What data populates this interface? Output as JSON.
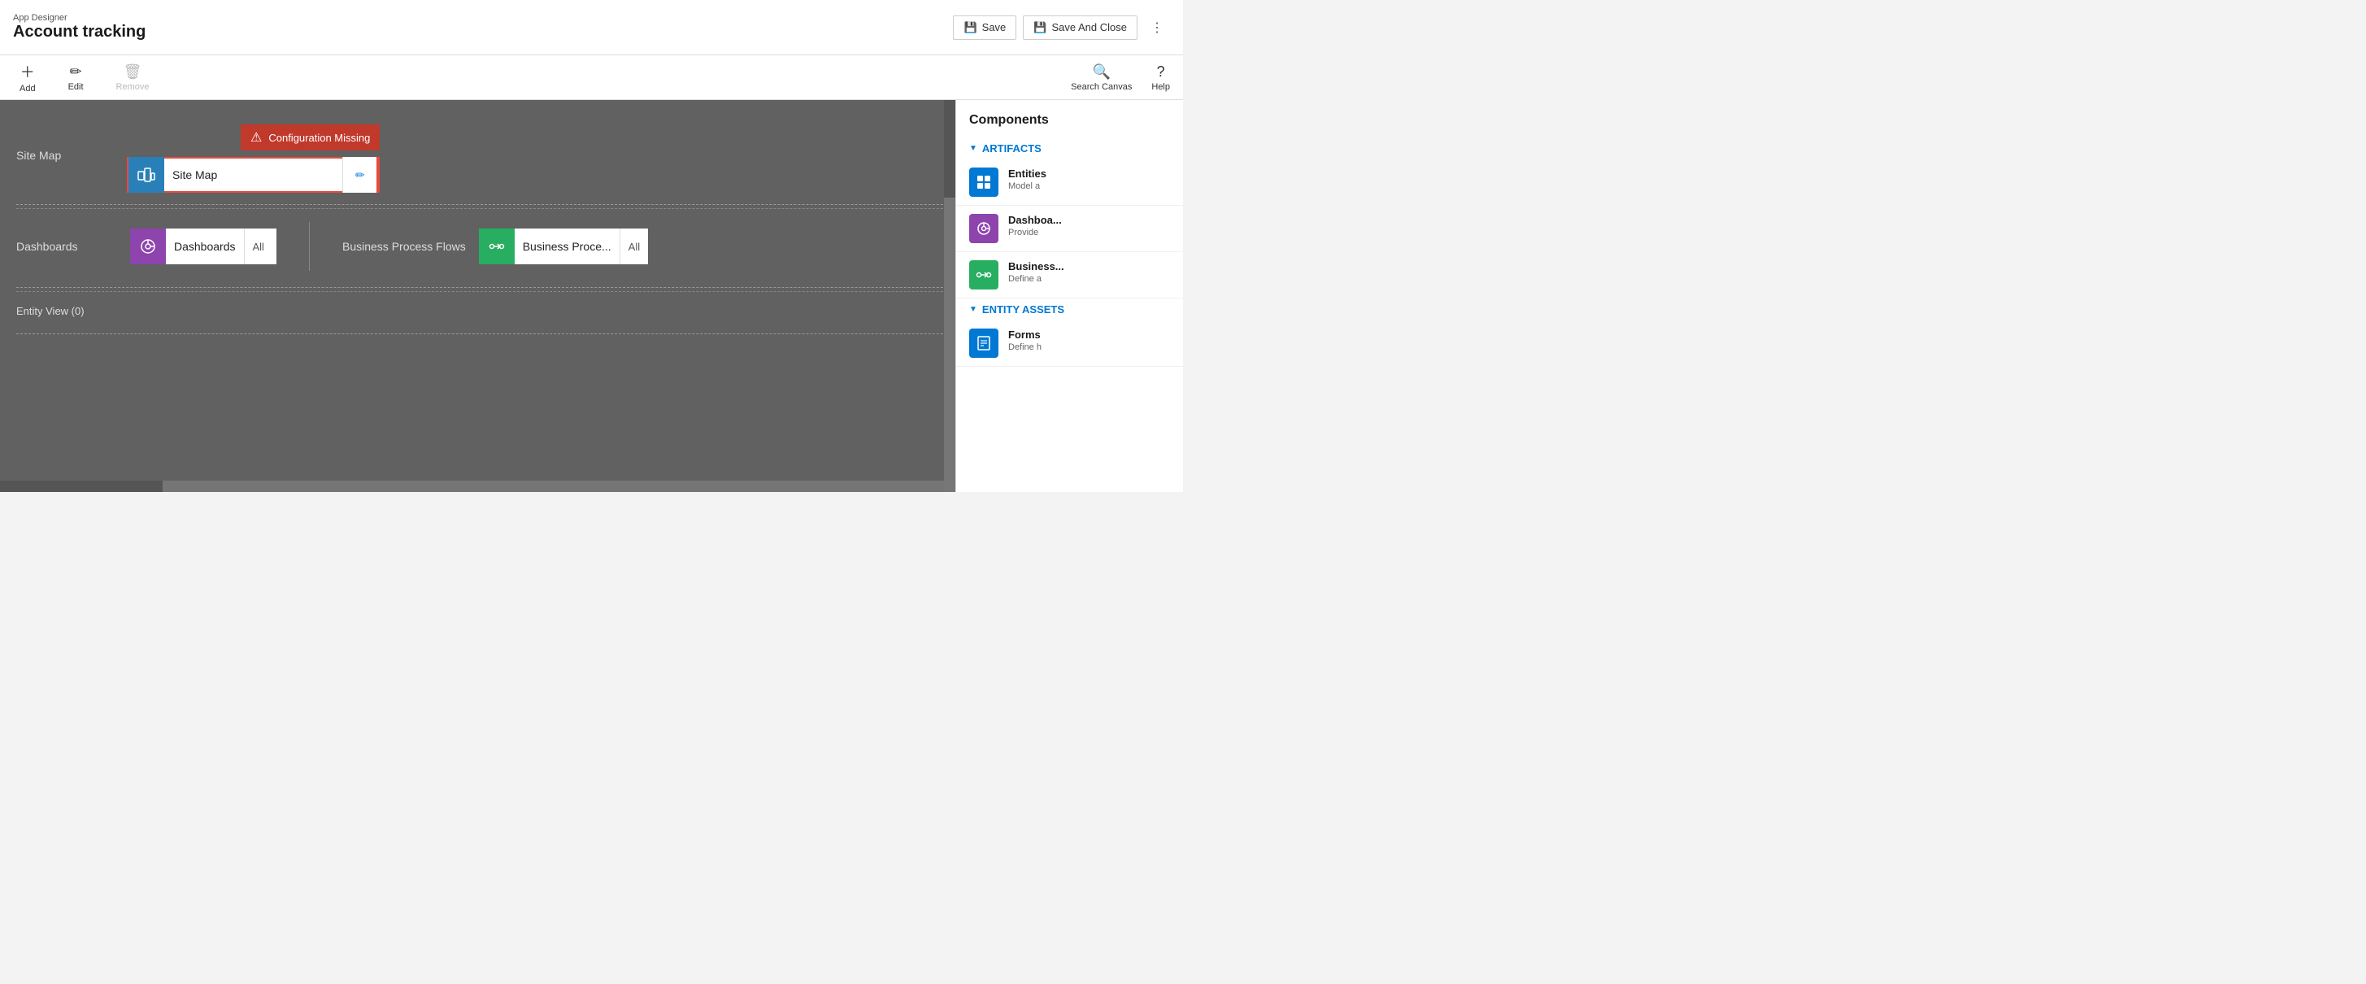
{
  "header": {
    "app_designer_label": "App Designer",
    "app_title": "Account tracking",
    "save_label": "Save",
    "save_close_label": "Save And Close"
  },
  "toolbar": {
    "add_label": "Add",
    "edit_label": "Edit",
    "remove_label": "Remove",
    "search_canvas_label": "Search Canvas",
    "help_label": "Help"
  },
  "canvas": {
    "config_missing_text": "Configuration Missing",
    "site_map_label": "Site Map",
    "site_map_card_label": "Site Map",
    "dashboards_label": "Dashboards",
    "dashboards_card_label": "Dashboards",
    "dashboards_all_label": "All",
    "business_process_label": "Business Process Flows",
    "business_process_card_label": "Business Proce...",
    "business_process_all_label": "All",
    "entity_view_label": "Entity View (0)"
  },
  "components": {
    "title": "Components",
    "artifacts_label": "ARTIFACTS",
    "entity_assets_label": "ENTITY ASSETS",
    "items": [
      {
        "name": "Entities",
        "desc": "Model a",
        "icon_type": "blue",
        "icon_char": "⊞"
      },
      {
        "name": "Dashboa...",
        "desc": "Provide",
        "icon_type": "purple",
        "icon_char": "◎"
      },
      {
        "name": "Business...",
        "desc": "Define a",
        "icon_type": "green",
        "icon_char": "⇄"
      },
      {
        "name": "Forms",
        "desc": "Define h",
        "icon_type": "blue",
        "icon_char": "☰"
      }
    ]
  }
}
